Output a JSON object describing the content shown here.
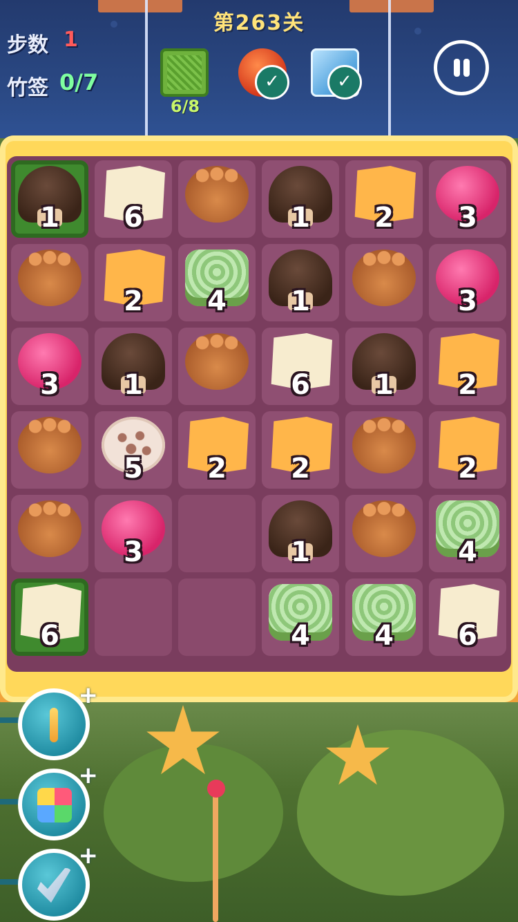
{
  "header": {
    "level_title": "第263关",
    "moves_label": "步数",
    "moves_value": "1",
    "sticks_label": "竹签",
    "sticks_value": "0/7",
    "goals": [
      {
        "name": "grass",
        "count": "6/8"
      },
      {
        "name": "ball",
        "completed": true
      },
      {
        "name": "ice",
        "completed": true
      }
    ]
  },
  "board": {
    "rows": [
      [
        {
          "type": "mushroom",
          "num": "1",
          "grass": true
        },
        {
          "type": "cheese",
          "num": "6"
        },
        {
          "type": "paw",
          "num": ""
        },
        {
          "type": "mushroom",
          "num": "1"
        },
        {
          "type": "cheese-orange",
          "num": "2"
        },
        {
          "type": "candy",
          "num": "3"
        }
      ],
      [
        {
          "type": "paw",
          "num": ""
        },
        {
          "type": "cheese-orange",
          "num": "2"
        },
        {
          "type": "swirl",
          "num": "4"
        },
        {
          "type": "mushroom",
          "num": "1"
        },
        {
          "type": "paw",
          "num": ""
        },
        {
          "type": "candy",
          "num": "3"
        }
      ],
      [
        {
          "type": "candy",
          "num": "3"
        },
        {
          "type": "mushroom",
          "num": "1"
        },
        {
          "type": "paw",
          "num": ""
        },
        {
          "type": "cheese",
          "num": "6"
        },
        {
          "type": "mushroom",
          "num": "1"
        },
        {
          "type": "cheese-orange",
          "num": "2"
        }
      ],
      [
        {
          "type": "paw",
          "num": ""
        },
        {
          "type": "lotus",
          "num": "5"
        },
        {
          "type": "cheese-orange",
          "num": "2"
        },
        {
          "type": "cheese-orange",
          "num": "2"
        },
        {
          "type": "paw",
          "num": ""
        },
        {
          "type": "cheese-orange",
          "num": "2"
        }
      ],
      [
        {
          "type": "paw",
          "num": ""
        },
        {
          "type": "candy",
          "num": "3"
        },
        {
          "type": "empty",
          "num": ""
        },
        {
          "type": "mushroom",
          "num": "1"
        },
        {
          "type": "paw",
          "num": ""
        },
        {
          "type": "swirl",
          "num": "4"
        }
      ],
      [
        {
          "type": "cheese",
          "num": "6",
          "grass": true
        },
        {
          "type": "empty",
          "num": ""
        },
        {
          "type": "empty",
          "num": ""
        },
        {
          "type": "swirl",
          "num": "4"
        },
        {
          "type": "swirl",
          "num": "4"
        },
        {
          "type": "cheese",
          "num": "6"
        }
      ]
    ]
  },
  "boosters": [
    {
      "name": "skewer",
      "plus": "+"
    },
    {
      "name": "rubik-cube",
      "plus": "+"
    },
    {
      "name": "shovel",
      "plus": "+"
    }
  ]
}
